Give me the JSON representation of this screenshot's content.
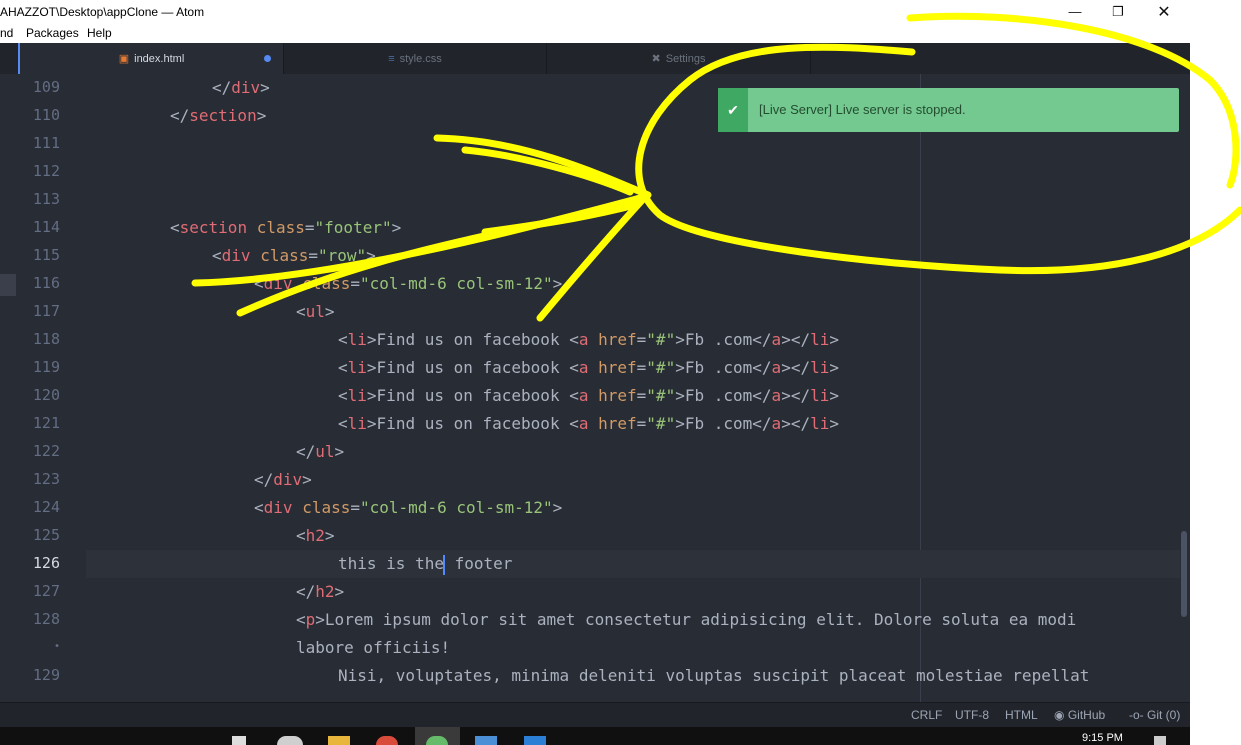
{
  "window": {
    "title": "AHAZZOT\\Desktop\\appClone — Atom",
    "minimize_icon": "minimize-icon",
    "maximize_icon": "maximize-icon",
    "close_icon": "close-icon"
  },
  "menu": [
    "nd",
    "Packages",
    "Help"
  ],
  "tabs": [
    {
      "label": "index.html",
      "icon": "html5-icon",
      "modified": true,
      "active": true
    },
    {
      "label": "style.css",
      "icon": "css3-icon",
      "modified": false,
      "active": false
    },
    {
      "label": "Settings",
      "icon": "settings-icon",
      "modified": false,
      "active": false
    }
  ],
  "notification": {
    "type": "success",
    "icon": "check-icon",
    "message": "[Live Server] Live server is stopped."
  },
  "gutter": [
    "109",
    "110",
    "111",
    "112",
    "113",
    "114",
    "115",
    "116",
    "117",
    "118",
    "119",
    "120",
    "121",
    "122",
    "123",
    "124",
    "125",
    "126",
    "127",
    "128",
    "•",
    "129"
  ],
  "current_line": "126",
  "code_text": {
    "l109": "</div>",
    "l110": "</section>",
    "l114_class_value": "\"footer\"",
    "l115_class_value": "\"row\"",
    "l116_visible": "<div class= col-md-6 col-sm-12\">",
    "l117": "<ul>",
    "li_text": "Find us on facebook ",
    "href_value": "\"#\"",
    "a_text": "Fb .com",
    "l122": "</ul>",
    "l123": "</div>",
    "l124_class_value": "\"col-md-6 col-sm-12\"",
    "l125": "<h2>",
    "l126_before_cursor": "this is the",
    "l126_after_cursor": " footer",
    "l127": "</h2>",
    "l128_text": "Lorem ipsum dolor sit amet consectetur adipisicing elit. Dolore soluta ea modi",
    "l128_wrap": "labore officiis!",
    "l129_text": "Nisi, voluptates, minima deleniti voluptas suscipit placeat molestiae repellat"
  },
  "status": {
    "line_ending": "CRLF",
    "encoding": "UTF-8",
    "grammar": "HTML",
    "github": "GitHub",
    "git": "Git (0)"
  },
  "taskbar": {
    "clock": "9:15 PM"
  },
  "colors": {
    "annotation": "#ffff00",
    "notification_bg": "#73c990",
    "editor_bg": "#282c34",
    "tag": "#e06c75",
    "attr": "#d19a66",
    "string": "#98c379"
  }
}
